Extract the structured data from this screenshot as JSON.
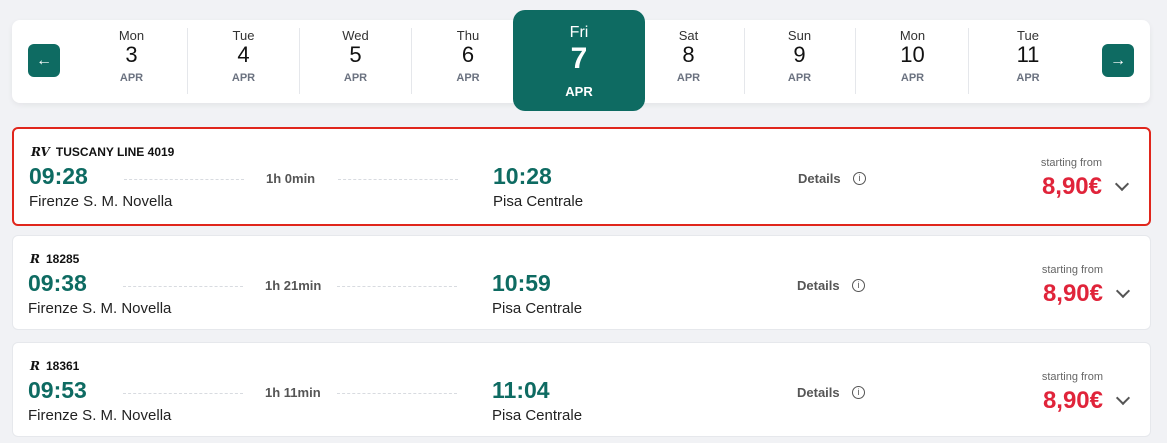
{
  "dates": {
    "prev_label": "←",
    "next_label": "→",
    "days": [
      {
        "dow": "Mon",
        "num": "3",
        "mon": "APR"
      },
      {
        "dow": "Tue",
        "num": "4",
        "mon": "APR"
      },
      {
        "dow": "Wed",
        "num": "5",
        "mon": "APR"
      },
      {
        "dow": "Thu",
        "num": "6",
        "mon": "APR"
      },
      {
        "dow": "Fri",
        "num": "7",
        "mon": "APR",
        "selected": true
      },
      {
        "dow": "Sat",
        "num": "8",
        "mon": "APR"
      },
      {
        "dow": "Sun",
        "num": "9",
        "mon": "APR"
      },
      {
        "dow": "Mon",
        "num": "10",
        "mon": "APR"
      },
      {
        "dow": "Tue",
        "num": "11",
        "mon": "APR"
      }
    ]
  },
  "trains": [
    {
      "logo": "RV",
      "name": "TUSCANY LINE 4019",
      "dep": "09:28",
      "from": "Firenze S. M. Novella",
      "dur": "1h 0min",
      "arr": "10:28",
      "to": "Pisa Centrale",
      "details": "Details",
      "starting": "starting from",
      "price": "8,90€"
    },
    {
      "logo": "R",
      "name": "18285",
      "dep": "09:38",
      "from": "Firenze S. M. Novella",
      "dur": "1h 21min",
      "arr": "10:59",
      "to": "Pisa Centrale",
      "details": "Details",
      "starting": "starting from",
      "price": "8,90€"
    },
    {
      "logo": "R",
      "name": "18361",
      "dep": "09:53",
      "from": "Firenze S. M. Novella",
      "dur": "1h 11min",
      "arr": "11:04",
      "to": "Pisa Centrale",
      "details": "Details",
      "starting": "starting from",
      "price": "8,90€"
    }
  ],
  "colors": {
    "accent": "#0e6b62",
    "price": "#e0243a",
    "highlight": "#e0261c"
  }
}
